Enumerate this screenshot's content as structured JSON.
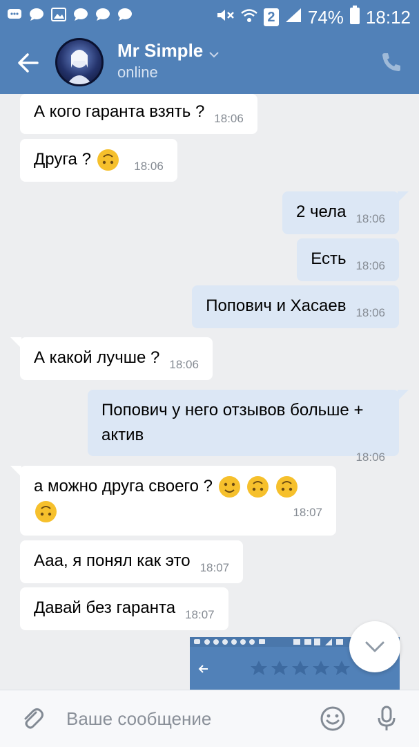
{
  "status_bar": {
    "battery_percent": "74%",
    "time": "18:12",
    "sim_label": "2"
  },
  "header": {
    "contact_name": "Mr Simple",
    "contact_status": "online"
  },
  "messages": [
    {
      "dir": "in",
      "text": "А кого гаранта взять ?",
      "time": "18:06"
    },
    {
      "dir": "in",
      "text": "Друга ?",
      "time": "18:06"
    },
    {
      "dir": "out",
      "text": "2 чела",
      "time": "18:06"
    },
    {
      "dir": "out",
      "text": "Есть",
      "time": "18:06"
    },
    {
      "dir": "out",
      "text": "Попович и Хасаев",
      "time": "18:06"
    },
    {
      "dir": "in",
      "text": "А какой лучше ?",
      "time": "18:06"
    },
    {
      "dir": "out",
      "text": "Попович у него отзывов больше + актив",
      "time": "18:06"
    },
    {
      "dir": "in",
      "text": "а можно друга своего ?",
      "time": "18:07"
    },
    {
      "dir": "in",
      "text": "Ааа, я понял как это",
      "time": "18:07"
    },
    {
      "dir": "in",
      "text": "Давай без гаранта",
      "time": "18:07"
    }
  ],
  "composer": {
    "placeholder": "Ваше сообщение"
  },
  "colors": {
    "brand": "#5181b8",
    "incoming_bubble": "#ffffff",
    "outgoing_bubble": "#dce7f5",
    "chat_background": "#edeef0"
  }
}
